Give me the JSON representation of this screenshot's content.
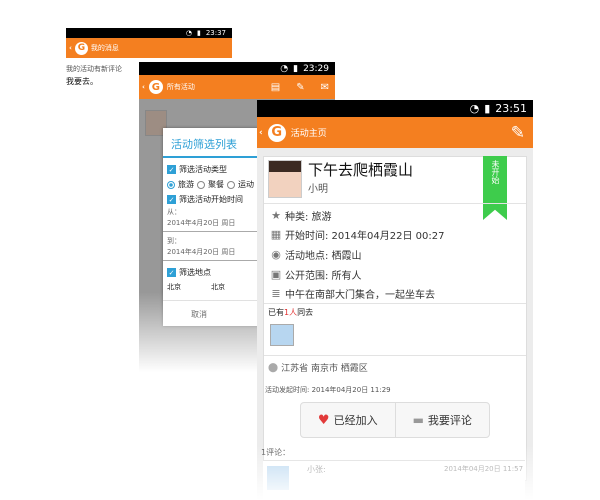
{
  "back": {
    "time": "23:37",
    "title": "我的消息",
    "message_label": "我的活动有新评论",
    "message_text": "我要去。"
  },
  "middle": {
    "time": "23:29",
    "title": "所有活动",
    "dialog": {
      "title": "活动筛选列表",
      "type_filter": "筛选活动类型",
      "types": [
        "旅游",
        "聚餐",
        "运动"
      ],
      "time_filter": "筛选活动开始时间",
      "from_label": "从：",
      "from_date": "2014年4月20日 周日",
      "to_label": "到：",
      "to_date": "2014年4月20日 周日",
      "loc_filter": "筛选地点",
      "province": "北京",
      "city": "北京",
      "cancel": "取消"
    }
  },
  "front": {
    "time": "23:51",
    "title": "活动主页",
    "activity": {
      "name": "下午去爬栖霞山",
      "owner": "小明",
      "status": "未开始",
      "category": "种类: 旅游",
      "start_time": "开始时间: 2014年04月22日 00:27",
      "place": "活动地点: 栖霞山",
      "visibility": "公开范围: 所有人",
      "description": "中午在南部大门集合，一起坐车去",
      "joined_pre": "已有",
      "joined_count": "1人",
      "joined_post": "同去",
      "location": "江苏省 南京市 栖霞区",
      "posted": "活动发起时间: 2014年04月20日 11:29"
    },
    "joined_btn": "已经加入",
    "comment_btn": "我要评论",
    "comment_count": "1评论：",
    "comment": {
      "name": "小张:",
      "time": "2014年04月20日 11:57"
    }
  }
}
